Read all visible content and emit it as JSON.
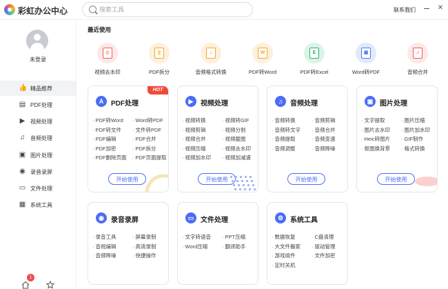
{
  "app": {
    "title": "彩虹办公中心"
  },
  "search": {
    "placeholder": "搜索工具"
  },
  "header": {
    "contact": "联系我们"
  },
  "sidebar": {
    "login_status": "未登录",
    "badge_count": "1",
    "items": [
      {
        "label": "精品推荐",
        "icon": "thumbs-up-icon",
        "glyph": "👍"
      },
      {
        "label": "PDF处理",
        "icon": "pdf-icon",
        "glyph": "▤"
      },
      {
        "label": "视频处理",
        "icon": "video-icon",
        "glyph": "▶"
      },
      {
        "label": "音频处理",
        "icon": "music-icon",
        "glyph": "♫"
      },
      {
        "label": "图片处理",
        "icon": "image-icon",
        "glyph": "▣"
      },
      {
        "label": "录音录屏",
        "icon": "microphone-icon",
        "glyph": "◉"
      },
      {
        "label": "文件处理",
        "icon": "folder-icon",
        "glyph": "▭"
      },
      {
        "label": "系统工具",
        "icon": "toolbox-icon",
        "glyph": "▦"
      }
    ]
  },
  "recent": {
    "title": "最近使用",
    "items": [
      {
        "label": "视频去水印",
        "color": "#f25a5a",
        "bg": "#fde8e8",
        "glyph": "◇"
      },
      {
        "label": "PDF拆分",
        "color": "#f4a623",
        "bg": "#fdf0dc",
        "glyph": "||"
      },
      {
        "label": "音频格式转换",
        "color": "#f4a623",
        "bg": "#fdf0dc",
        "glyph": "♫"
      },
      {
        "label": "PDF转Word",
        "color": "#f4a623",
        "bg": "#fdf0dc",
        "glyph": "W"
      },
      {
        "label": "PDF转Excel",
        "color": "#2eaf6e",
        "bg": "#dcf4e8",
        "glyph": "E"
      },
      {
        "label": "Word转PDF",
        "color": "#4a78f0",
        "bg": "#e1e9fc",
        "glyph": "▣"
      },
      {
        "label": "音频合并",
        "color": "#f25a5a",
        "bg": "#fde8e8",
        "glyph": "♫"
      }
    ]
  },
  "cards": [
    {
      "title": "PDF处理",
      "hot": "HOT",
      "color": "#4a6cf7",
      "glyph": "A",
      "features": [
        "PDF转Word",
        "Word转PDF",
        "PDF转文件",
        "文件转PDF",
        "PDF编辑",
        "PDF合并",
        "PDF加密",
        "PDF拆分",
        "PDF删除页面",
        "PDF页面提取"
      ],
      "button": "开始使用"
    },
    {
      "title": "视频处理",
      "color": "#4a6cf7",
      "glyph": "▶",
      "features": [
        "视频转换",
        "视频转GIF",
        "视频剪辑",
        "视频分割",
        "视频合并",
        "视频截图",
        "视频压缩",
        "视频去水印",
        "视频加水印",
        "视频加减速"
      ],
      "button": "开始使用"
    },
    {
      "title": "音频处理",
      "color": "#4a6cf7",
      "glyph": "♫",
      "features": [
        "音频转换",
        "音频剪辑",
        "音频转文字",
        "音频合并",
        "音频提取",
        "音频变速",
        "音频调整",
        "音频降噪"
      ],
      "button": "开始使用"
    },
    {
      "title": "图片处理",
      "color": "#4a6cf7",
      "glyph": "▣",
      "features": [
        "文字提取",
        "图片压缩",
        "图片去水印",
        "图片加水印",
        "Heic转图片",
        "GIF制作",
        "抠图换背景",
        "格式转换"
      ],
      "button": "开始使用"
    },
    {
      "title": "录音录屏",
      "color": "#4a6cf7",
      "glyph": "◉",
      "features": [
        "录音工具",
        "屏幕录制",
        "音视编辑",
        "高清录制",
        "音频降噪",
        "快捷操作"
      ]
    },
    {
      "title": "文件处理",
      "color": "#4a6cf7",
      "glyph": "▭",
      "features": [
        "文字转语音",
        "PPT压缩",
        "Word压缩",
        "翻译助手"
      ]
    },
    {
      "title": "系统工具",
      "color": "#4a6cf7",
      "glyph": "⚙",
      "features": [
        "数据恢复",
        "C盘清理",
        "大文件搬家",
        "驱动管理",
        "游戏组件",
        "文件加密",
        "定时关机"
      ]
    }
  ]
}
